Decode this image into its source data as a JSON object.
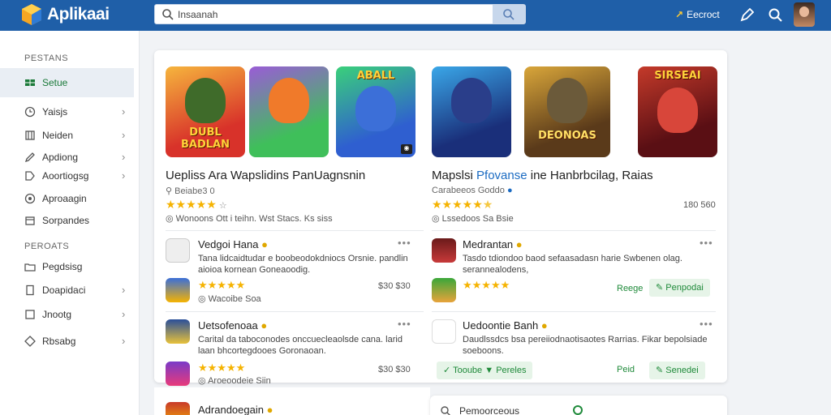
{
  "app": {
    "brand": "Aplikaai"
  },
  "search": {
    "value": "Insaanah"
  },
  "topbar": {
    "discover_label": "Eecroct"
  },
  "sidebar": {
    "section1": "PESTANS",
    "section2": "PEROATS",
    "items": [
      {
        "label": "Setue",
        "icon": "grid-icon",
        "active": true
      },
      {
        "label": "Yaisjs",
        "icon": "clock-icon"
      },
      {
        "label": "Neiden",
        "icon": "building-icon"
      },
      {
        "label": "Apdiong",
        "icon": "pencil-icon"
      },
      {
        "label": "Aoortiogsg",
        "icon": "tag-icon"
      },
      {
        "label": "Aproaagin",
        "icon": "circle-icon"
      },
      {
        "label": "Sorpandes",
        "icon": "box-icon"
      },
      {
        "label": "Pegdsisg",
        "icon": "folder-icon"
      },
      {
        "label": "Doapidaci",
        "icon": "document-icon"
      },
      {
        "label": "Jnootg",
        "icon": "square-icon"
      },
      {
        "label": "Rbsabg",
        "icon": "tag-icon"
      }
    ]
  },
  "left_app": {
    "thumbs": [
      "DUBL BADLAN",
      "",
      "ABALL"
    ],
    "title": "Uepliss Ara Wapslidins PanUagnsnin",
    "sub": "Beiabe3 0",
    "meta": "Wonoons Ott  i teihn.  Wst Stacs.  Ks siss",
    "reviews": [
      {
        "name": "Vedgoi Hana",
        "text": "Tana  lidcaidtudar e boobeodokdniocs Orsnie. pandlin aioioa kornean Goneaoodig.",
        "stars": "★★★★★",
        "meta": "Wacoibe  Soa",
        "price": "$30  $30"
      },
      {
        "name": "Uetsofenoaa",
        "text": "Carital da taboconodes onccuecleaolsde cana. larid laan bhcortegdooes Goronaoan.",
        "stars": "★★★★★",
        "meta": "Aroeoodeie  Siin",
        "price": "$30  $30"
      },
      {
        "name": "Adrandoegain"
      }
    ]
  },
  "right_app": {
    "thumbs": [
      "",
      "DEONOAS",
      "SIRSEAI"
    ],
    "title_pre": "Mapslsi",
    "title_blue": "Pfovanse",
    "title_post": "ine Hanbrbcilag, Raias",
    "sub": "Carabeeos  Goddo",
    "price": "180  560",
    "meta": "Lssedoos  Sa  Bsie",
    "reviews": [
      {
        "name": "Medrantan",
        "text": "Tasdo tdiondoo  baod sefaasadasn  harie  Swbenen  olag. serannealodens,",
        "stars": "★★★★★",
        "action": "Reege",
        "pill": "Penpodai"
      },
      {
        "name": "Uedoontie Banh",
        "text": "Daudlssdcs  bsa pereiiodnaotisaotes  Rarrias. Fikar bepolsiade soeboons."
      }
    ],
    "bottom": {
      "left": "Tooube",
      "left2": "Pereles",
      "action": "Peid",
      "pill": "Senedei"
    }
  },
  "bottom_card": {
    "label": "Pemoorceous"
  },
  "colors": {
    "topbar": "#1f5fa8",
    "accent_green": "#1f8a3a",
    "star": "#f5b301"
  }
}
